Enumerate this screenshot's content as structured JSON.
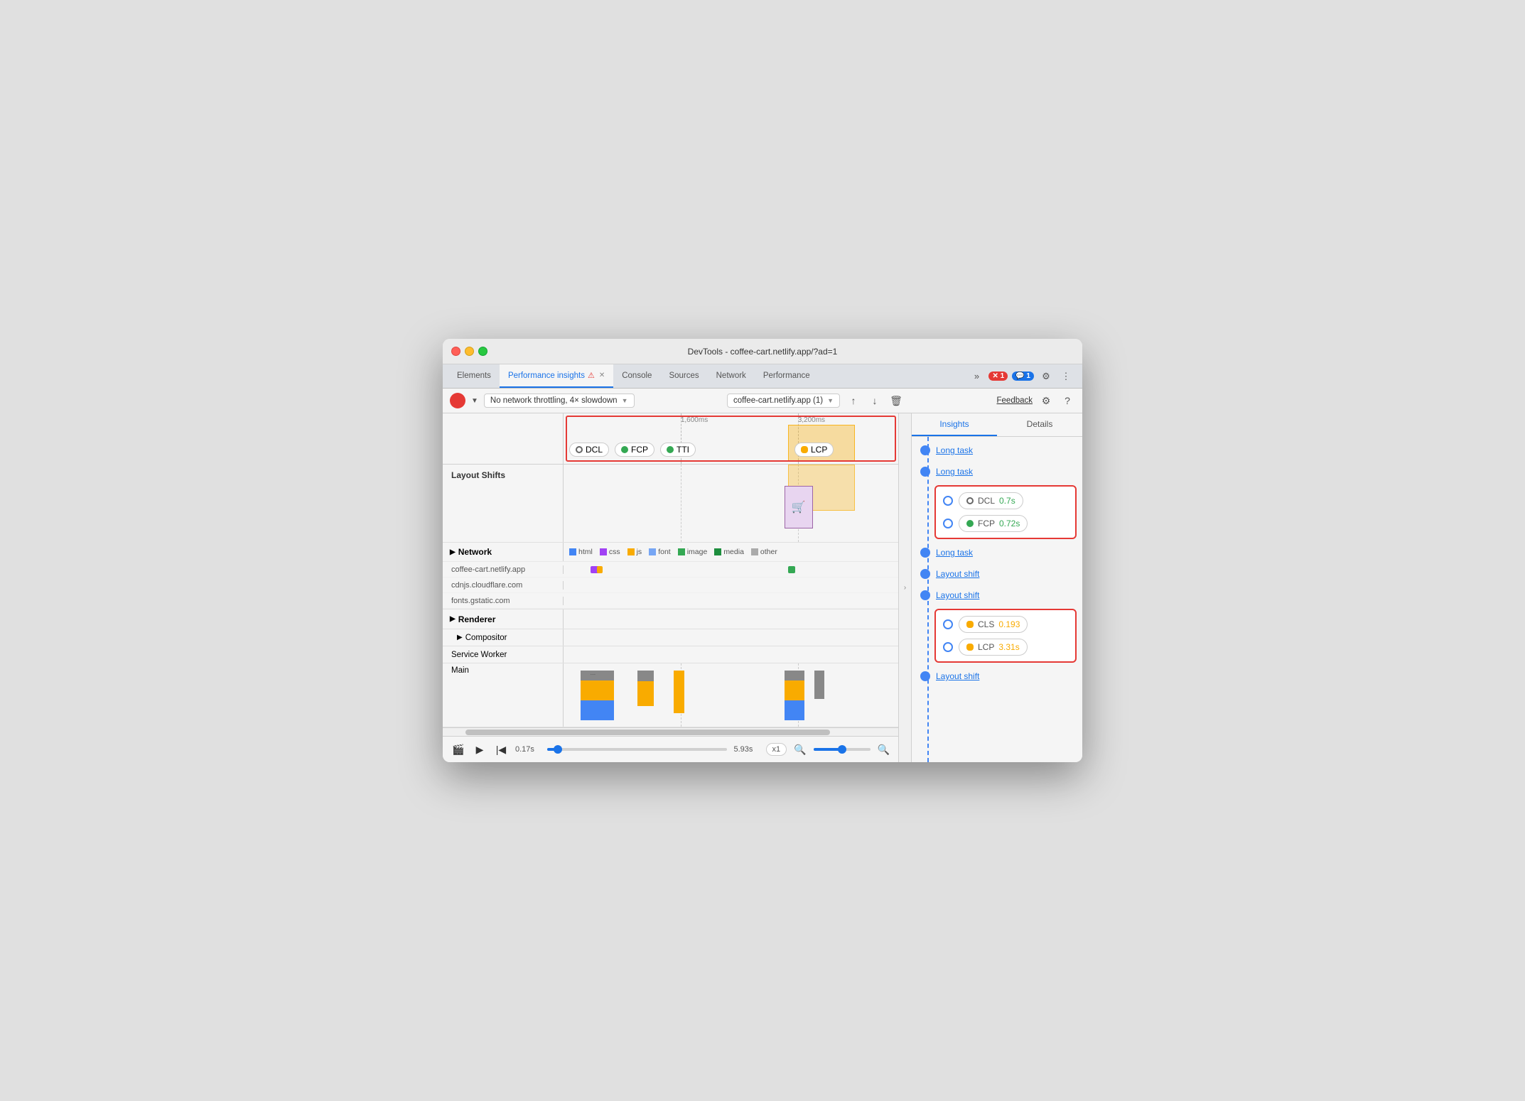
{
  "window": {
    "title": "DevTools - coffee-cart.netlify.app/?ad=1"
  },
  "tabs": [
    {
      "label": "Elements",
      "active": false
    },
    {
      "label": "Performance insights",
      "active": true,
      "has_dot": true
    },
    {
      "label": "Console",
      "active": false
    },
    {
      "label": "Sources",
      "active": false
    },
    {
      "label": "Network",
      "active": false
    },
    {
      "label": "Performance",
      "active": false
    }
  ],
  "toolbar": {
    "network_throttle": "No network throttling, 4× slowdown",
    "url": "coffee-cart.netlify.app (1)",
    "feedback_label": "Feedback"
  },
  "timeline": {
    "marker_1600": "1,600ms",
    "marker_3200": "3,200ms",
    "dcl_label": "DCL",
    "fcp_label": "FCP",
    "tti_label": "TTI",
    "lcp_label": "LCP"
  },
  "sections": {
    "layout_shifts_label": "Layout Shifts",
    "network_label": "Network",
    "renderer_label": "Renderer",
    "compositor_label": "Compositor",
    "service_worker_label": "Service Worker",
    "main_label": "Main"
  },
  "network_legend": {
    "html": "html",
    "css": "css",
    "js": "js",
    "font": "font",
    "image": "image",
    "media": "media",
    "other": "other"
  },
  "network_rows": [
    {
      "label": "coffee-cart.netlify.app"
    },
    {
      "label": "cdnjs.cloudflare.com"
    },
    {
      "label": "fonts.gstatic.com"
    }
  ],
  "player": {
    "time_start": "0.17s",
    "time_end": "5.93s",
    "speed": "x1",
    "progress_pct": 6
  },
  "insights": {
    "tabs": [
      "Insights",
      "Details"
    ],
    "active_tab": "Insights",
    "items": [
      {
        "type": "link",
        "label": "Long task"
      },
      {
        "type": "link",
        "label": "Long task"
      },
      {
        "type": "metric",
        "key": "DCL",
        "value": "0.7s",
        "color": "neutral"
      },
      {
        "type": "metric",
        "key": "FCP",
        "value": "0.72s",
        "color": "good"
      },
      {
        "type": "link",
        "label": "Long task"
      },
      {
        "type": "link",
        "label": "Layout shift"
      },
      {
        "type": "link",
        "label": "Layout shift"
      },
      {
        "type": "metric",
        "key": "CLS",
        "value": "0.193",
        "color": "warn"
      },
      {
        "type": "metric",
        "key": "LCP",
        "value": "3.31s",
        "color": "warn"
      },
      {
        "type": "link",
        "label": "Layout shift"
      }
    ]
  }
}
